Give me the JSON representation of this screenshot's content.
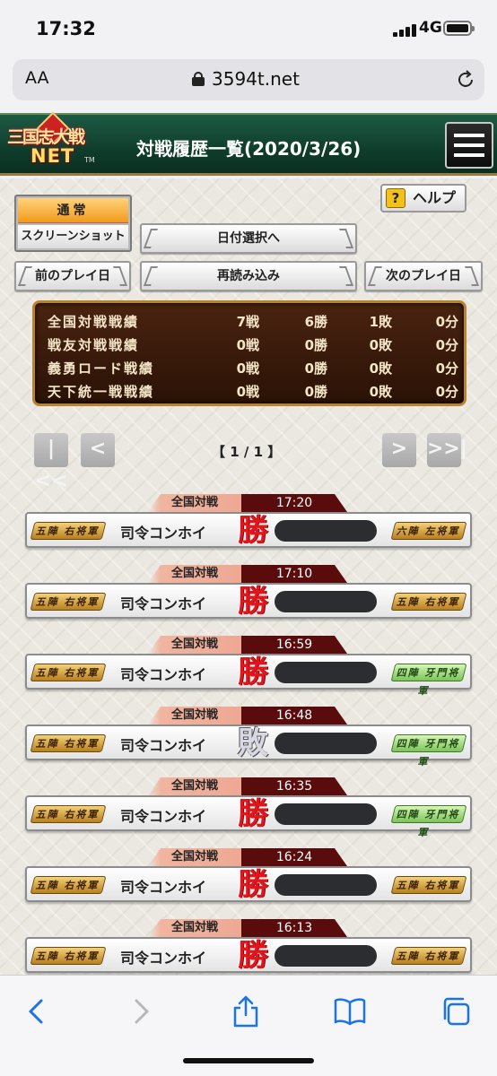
{
  "status": {
    "time": "17:32",
    "network": "4G"
  },
  "browser": {
    "aa": "AA",
    "url": "3594t.net"
  },
  "header": {
    "title": "対戦履歴一覧(2020/3/26)",
    "logo_line1": "三国志大戦",
    "logo_line2": "NET",
    "logo_tm": "TM"
  },
  "tabs": {
    "normal": "通常",
    "screenshot": "スクリーンショット"
  },
  "help_label": "ヘルプ",
  "buttons": {
    "date_select": "日付選択へ",
    "prev_day": "前のプレイ日",
    "reload": "再読み込み",
    "next_day": "次のプレイ日"
  },
  "stats": [
    {
      "label": "全国対戦戦績",
      "battles": "7戦",
      "wins": "6勝",
      "losses": "1敗",
      "draws": "0分"
    },
    {
      "label": "戦友対戦戦績",
      "battles": "0戦",
      "wins": "0勝",
      "losses": "0敗",
      "draws": "0分"
    },
    {
      "label": "義勇ロード戦績",
      "battles": "0戦",
      "wins": "0勝",
      "losses": "0敗",
      "draws": "0分"
    },
    {
      "label": "天下統一戦戦績",
      "battles": "0戦",
      "wins": "0勝",
      "losses": "0敗",
      "draws": "0分"
    }
  ],
  "pager": {
    "text": "【 1 / 1 】",
    "first": "|<<",
    "prev": "<",
    "next": ">",
    "last": ">>|"
  },
  "matches": [
    {
      "mode": "全国対戦",
      "time": "17:20",
      "my_rank": "五陣 右将軍",
      "player": "司令コンホイ",
      "result": "勝",
      "opp_rank": "六陣 左将軍"
    },
    {
      "mode": "全国対戦",
      "time": "17:10",
      "my_rank": "五陣 右将軍",
      "player": "司令コンホイ",
      "result": "勝",
      "opp_rank": "五陣 右将軍"
    },
    {
      "mode": "全国対戦",
      "time": "16:59",
      "my_rank": "五陣 右将軍",
      "player": "司令コンホイ",
      "result": "勝",
      "opp_rank": "四陣 牙門将軍"
    },
    {
      "mode": "全国対戦",
      "time": "16:48",
      "my_rank": "五陣 右将軍",
      "player": "司令コンホイ",
      "result": "敗",
      "opp_rank": "四陣 牙門将軍"
    },
    {
      "mode": "全国対戦",
      "time": "16:35",
      "my_rank": "五陣 右将軍",
      "player": "司令コンホイ",
      "result": "勝",
      "opp_rank": "四陣 牙門将軍"
    },
    {
      "mode": "全国対戦",
      "time": "16:24",
      "my_rank": "五陣 右将軍",
      "player": "司令コンホイ",
      "result": "勝",
      "opp_rank": "五陣 右将軍"
    },
    {
      "mode": "全国対戦",
      "time": "16:13",
      "my_rank": "五陣 右将軍",
      "player": "司令コンホイ",
      "result": "勝",
      "opp_rank": "五陣 右将軍"
    }
  ],
  "colors": {
    "header_green": "#0f3d2c",
    "stats_brown": "#2a1206",
    "win_red": "#e2141c",
    "tab_orange": "#f29a1e"
  }
}
